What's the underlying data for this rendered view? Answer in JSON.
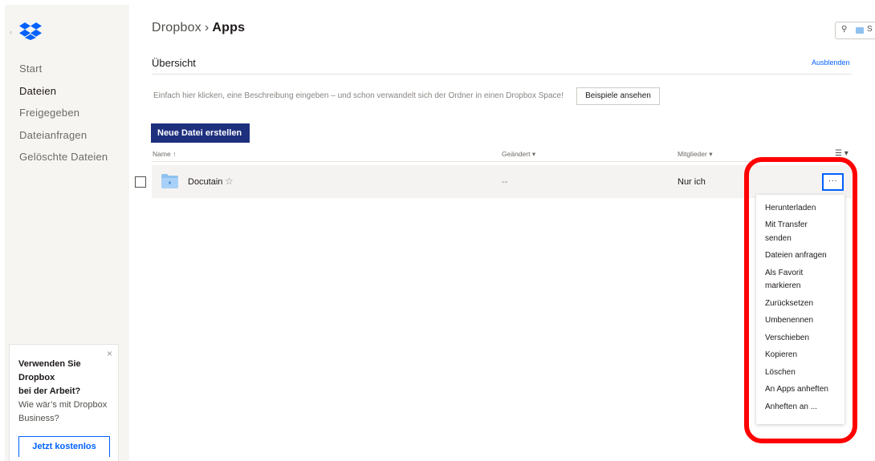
{
  "sidebar": {
    "nav": [
      "Start",
      "Dateien",
      "Freigegeben",
      "Dateianfragen",
      "Gelöschte Dateien"
    ],
    "active_index": 1,
    "promo": {
      "title_line1": "Verwenden Sie Dropbox",
      "title_line2": "bei der Arbeit?",
      "text": "Wie wär’s mit Dropbox Business?",
      "button": "Jetzt kostenlos",
      "close": "×"
    }
  },
  "header": {
    "crumb_root": "Dropbox",
    "crumb_sep": "›",
    "crumb_current": "Apps",
    "search_text": "S"
  },
  "overview": {
    "title": "Übersicht",
    "hide_link": "Ausblenden",
    "description_hint": "Einfach hier klicken, eine Beschreibung eingeben – und schon verwandelt sich der Ordner in einen Dropbox Space!",
    "examples_button": "Beispiele ansehen"
  },
  "toolbar": {
    "new_file_button": "Neue Datei erstellen",
    "new_file_chevron": "⌄"
  },
  "table": {
    "columns": {
      "name": "Name",
      "name_sort": "↑",
      "changed": "Geändert",
      "changed_sort": "▾",
      "members": "Mitglieder",
      "members_sort": "▾",
      "view_toggle": "☰ ▾"
    },
    "rows": [
      {
        "name": "Docutain",
        "star": "☆",
        "changed": "--",
        "members": "Nur ich",
        "more": "···"
      }
    ]
  },
  "context_menu": {
    "items": [
      "Herunterladen",
      "Mit Transfer senden",
      "Dateien anfragen",
      "Als Favorit markieren",
      "Zurücksetzen",
      "Umbenennen",
      "Verschieben",
      "Kopieren",
      "Löschen",
      "An Apps anheften",
      "Anheften an ..."
    ]
  },
  "colors": {
    "brand_blue": "#0061fe",
    "primary_button": "#1e2f7e",
    "highlight_outline": "#ff0000",
    "folder": "#8fc1f0"
  },
  "icons": {
    "logo": "dropbox-logo",
    "search": "search-icon",
    "folder": "folder-icon",
    "star": "star-icon",
    "more": "more-icon"
  }
}
